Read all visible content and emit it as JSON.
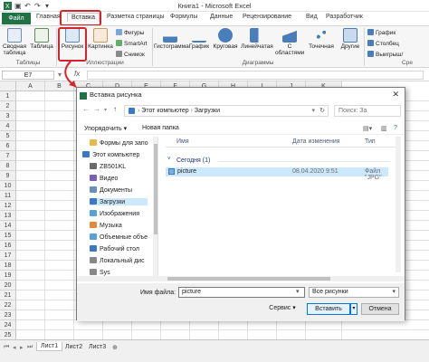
{
  "app": {
    "title": "Книга1 - Microsoft Excel"
  },
  "ribbon_tabs": [
    "Файл",
    "Главная",
    "Вставка",
    "Разметка страницы",
    "Формулы",
    "Данные",
    "Рецензирование",
    "Вид",
    "Разработчик"
  ],
  "ribbon": {
    "tables": {
      "pivot": "Сводная таблица",
      "table": "Таблица",
      "group": "Таблицы"
    },
    "illustrations": {
      "picture": "Рисунок",
      "clipart": "Картинка",
      "shapes": "Фигуры",
      "smartart": "SmartArt",
      "screenshot": "Снимок",
      "group": "Иллюстрации"
    },
    "charts": {
      "histogram": "Гистограмма",
      "graph": "График",
      "pie": "Круговая",
      "bar": "Линейчатая",
      "area": "С областями",
      "scatter": "Точечная",
      "other": "Другие",
      "group": "Диаграммы"
    },
    "sparklines": {
      "line": "График",
      "column": "Столбец",
      "winloss": "Выигрыш/",
      "cut": "Сре"
    }
  },
  "formula_bar": {
    "namebox": "E7"
  },
  "grid": {
    "columns": [
      "A",
      "B",
      "C",
      "D",
      "E",
      "F",
      "G",
      "H",
      "I",
      "J",
      "K"
    ],
    "rows": [
      "1",
      "2",
      "3",
      "4",
      "5",
      "6",
      "7",
      "8",
      "9",
      "10",
      "11",
      "12",
      "13",
      "14",
      "15",
      "16",
      "17",
      "18",
      "19",
      "20",
      "21",
      "22",
      "23",
      "24",
      "25"
    ]
  },
  "sheets": [
    "Лист1",
    "Лист2",
    "Лист3"
  ],
  "dialog": {
    "title": "Вставка рисунка",
    "address": [
      "Этот компьютер",
      "Загрузки"
    ],
    "search_placeholder": "Поиск: За",
    "organize": "Упорядочить ▾",
    "new_folder": "Новая папка",
    "nav_items": [
      "Формы для запо",
      "Этот компьютер",
      "ZB501KL",
      "Видео",
      "Документы",
      "Загрузки",
      "Изображения",
      "Музыка",
      "Объемные объе",
      "Рабочий стол",
      "Локальный дис",
      "Sys"
    ],
    "columns": {
      "name": "Имя",
      "date": "Дата изменения",
      "type": "Тип"
    },
    "group_label": "Сегодня (1)",
    "file": {
      "name": "picture",
      "date": "08.04.2020 9:51",
      "type": "Файл \"JPG\""
    },
    "filename_label": "Имя файла:",
    "filename_value": "picture",
    "filetype": "Все рисунки",
    "service": "Сервис",
    "insert": "Вставить",
    "cancel": "Отмена"
  },
  "colors": {
    "excel_green": "#217346",
    "highlight_red": "#d8232a",
    "selection_blue": "#cce8ff"
  }
}
